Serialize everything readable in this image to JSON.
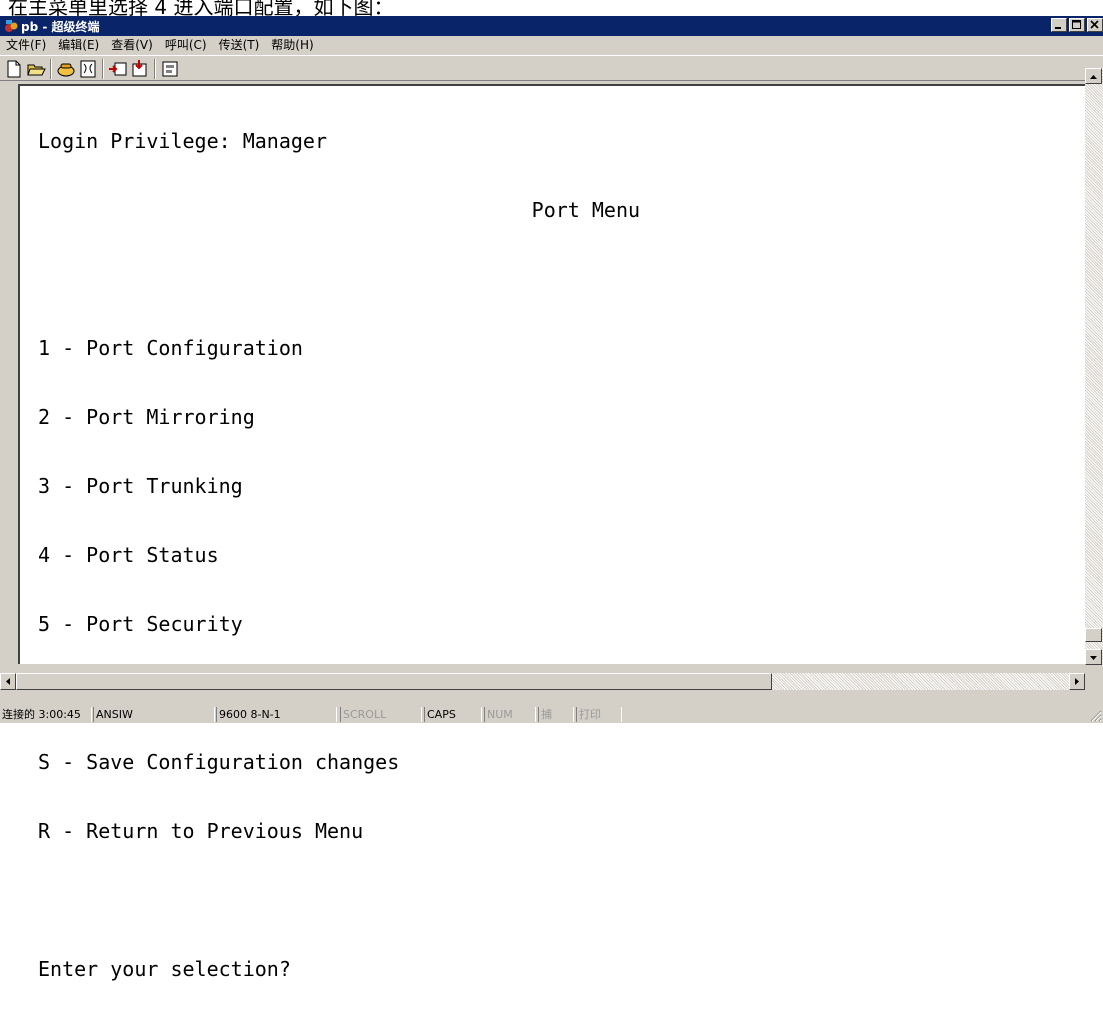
{
  "page_caption": "在主菜单里选择 4 进入端口配置，如下图：",
  "window": {
    "title": "pb - 超级终端"
  },
  "menu": [
    {
      "label": "文件(F)"
    },
    {
      "label": "编辑(E)"
    },
    {
      "label": "查看(V)"
    },
    {
      "label": "呼叫(C)"
    },
    {
      "label": "传送(T)"
    },
    {
      "label": "帮助(H)"
    }
  ],
  "toolbar": {
    "buttons": [
      "new-icon",
      "open-icon",
      "connect-icon",
      "disconnect-icon",
      "send-icon",
      "receive-icon",
      "properties-icon"
    ]
  },
  "terminal": {
    "lines": [
      "Login Privilege: Manager",
      "                                         Port Menu",
      "",
      "1 - Port Configuration",
      "2 - Port Mirroring",
      "3 - Port Trunking",
      "4 - Port Status",
      "5 - Port Security",
      "",
      "S - Save Configuration changes",
      "R - Return to Previous Menu",
      "",
      "Enter your selection?"
    ]
  },
  "statusbar": {
    "connected": "连接的 3:00:45",
    "emulation": "ANSIW",
    "settings": "9600 8-N-1",
    "scroll": "SCROLL",
    "caps": "CAPS",
    "num": "NUM",
    "capture": "捕",
    "print": "打印"
  },
  "colors": {
    "titlebar": "#0a246a",
    "chrome": "#d4d0c8",
    "terminal_bg": "#ffffff"
  }
}
